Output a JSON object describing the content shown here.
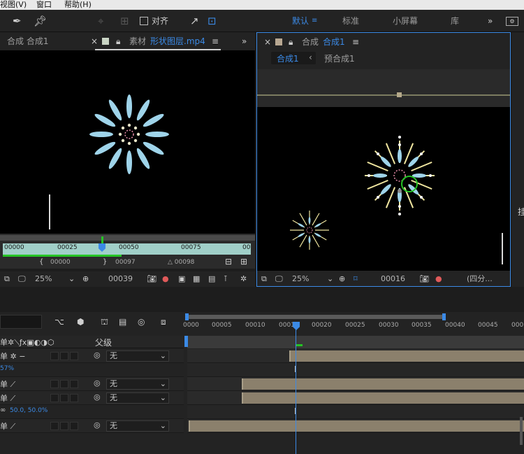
{
  "menu": {
    "view": "视图(V)",
    "window": "窗口",
    "help": "帮助(H)"
  },
  "toolbar": {
    "align_label": "对齐",
    "workspaces": [
      "默认",
      "标准",
      "小屏幕",
      "库"
    ],
    "more": "»"
  },
  "footage_panel": {
    "tab_comp": "合成 合成1",
    "tab_prefix": "素材",
    "tab_file": "形状图层.mp4",
    "ruler_ticks": [
      "00000",
      "00025",
      "00050",
      "00075",
      "00"
    ],
    "in_point": "00000",
    "out_point": "00097",
    "duration": "△ 00098",
    "zoom": "25%",
    "timecode": "00039"
  },
  "comp_panel": {
    "tab_prefix": "合成",
    "tab_name": "合成1",
    "breadcrumb_active": "合成1",
    "breadcrumb_other": "预合成1",
    "zoom": "25%",
    "timecode": "00016",
    "view_layout": "(四分..."
  },
  "timeline": {
    "ruler_ticks": [
      "0000",
      "00005",
      "00010",
      "00015",
      "00020",
      "00025",
      "00030",
      "00035",
      "00040",
      "00045",
      "000"
    ],
    "parent_header": "父级",
    "opacity_value": "57%",
    "scale_value": "50.0, 50.0%",
    "parent_none": "无",
    "rows": [
      {
        "parent": "无"
      },
      {
        "parent": "无"
      },
      {
        "parent": "无"
      },
      {
        "parent": "无"
      }
    ]
  },
  "colors": {
    "accent": "#3b8ae6",
    "clip": "#8b806c",
    "petal": "#9fd4ea",
    "spark": "#f0e6a0"
  }
}
